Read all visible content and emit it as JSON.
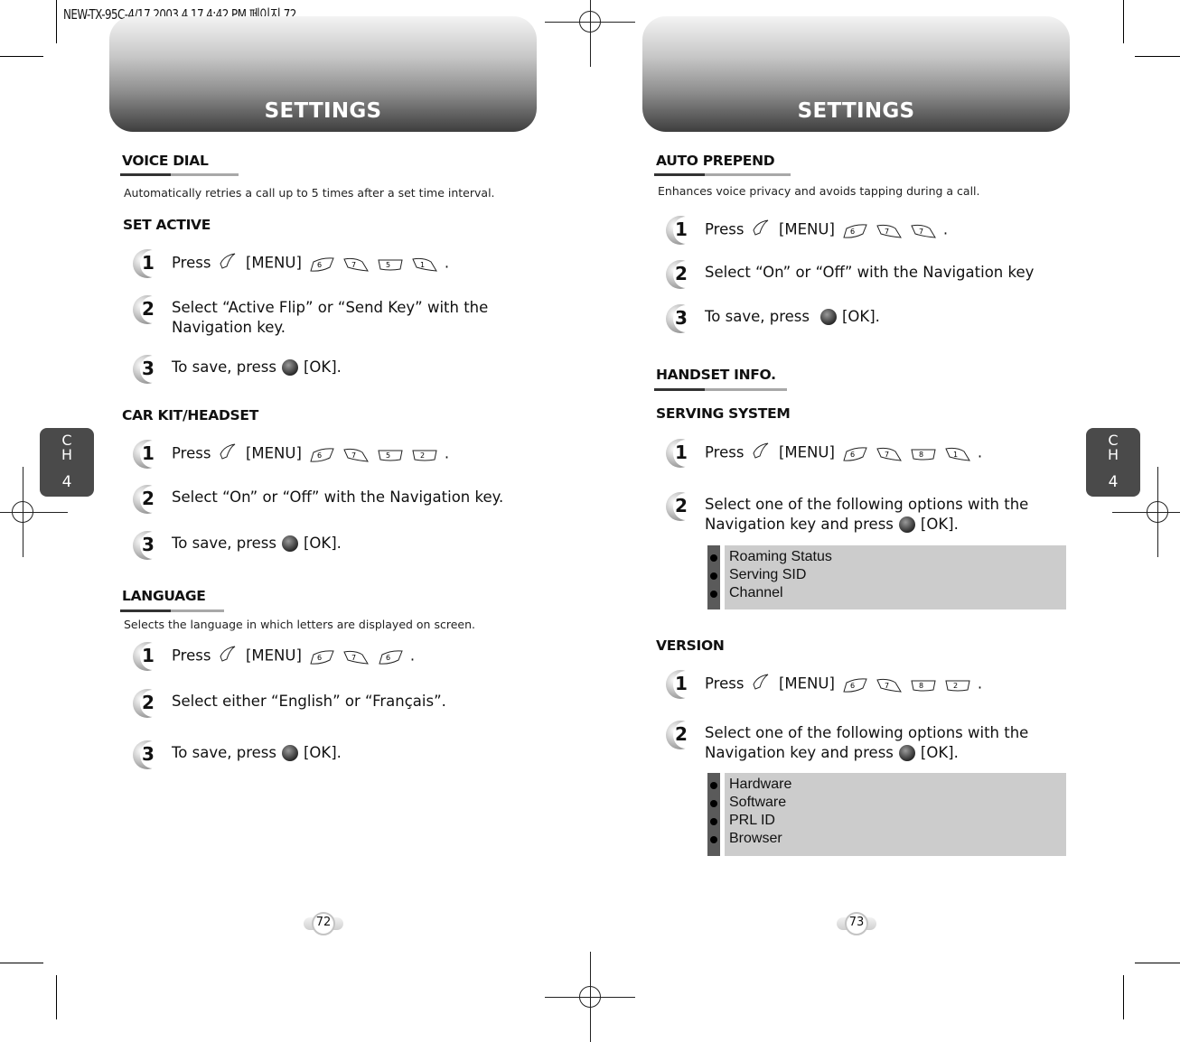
{
  "slug": "NEW-TX-95C-4/17  2003.4.17 4:42 PM 페이지 72",
  "left_page": {
    "header": "SETTINGS",
    "chapter_tab": {
      "c": "C",
      "h": "H",
      "num": "4"
    },
    "page_number": "72",
    "voice_dial": {
      "title": "VOICE DIAL",
      "description": "Automatically retries a call up to 5 times after a set time interval.",
      "set_active": {
        "title": "SET ACTIVE",
        "steps": [
          {
            "num": "1",
            "pre": "Press",
            "menu": "[MENU]",
            "keys": [
              "6",
              "7",
              "5",
              "1"
            ],
            "post": "."
          },
          {
            "num": "2",
            "line1": "Select “Active Flip” or “Send Key” with the",
            "line2": "Navigation key."
          },
          {
            "num": "3",
            "pre": "To save, press",
            "post": "[OK]."
          }
        ]
      }
    },
    "car_kit": {
      "title": "CAR KIT/HEADSET",
      "steps": [
        {
          "num": "1",
          "pre": "Press",
          "menu": "[MENU]",
          "keys": [
            "6",
            "7",
            "5",
            "2"
          ],
          "post": "."
        },
        {
          "num": "2",
          "text": "Select “On” or “Off” with the Navigation key."
        },
        {
          "num": "3",
          "pre": "To save, press",
          "post": "[OK]."
        }
      ]
    },
    "language": {
      "title": "LANGUAGE",
      "description": "Selects the language in which letters are displayed on screen.",
      "steps": [
        {
          "num": "1",
          "pre": "Press",
          "menu": "[MENU]",
          "keys": [
            "6",
            "7",
            "6"
          ],
          "post": "."
        },
        {
          "num": "2",
          "text": "Select either “English” or “Français”."
        },
        {
          "num": "3",
          "pre": "To save, press",
          "post": "[OK]."
        }
      ]
    }
  },
  "right_page": {
    "header": "SETTINGS",
    "chapter_tab": {
      "c": "C",
      "h": "H",
      "num": "4"
    },
    "page_number": "73",
    "auto_prepend": {
      "title": "AUTO PREPEND",
      "description": "Enhances voice privacy and avoids tapping during a call.",
      "steps": [
        {
          "num": "1",
          "pre": "Press",
          "menu": "[MENU]",
          "keys": [
            "6",
            "7",
            "7"
          ],
          "post": "."
        },
        {
          "num": "2",
          "text": "Select “On” or “Off” with the Navigation key"
        },
        {
          "num": "3",
          "pre": "To save, press",
          "post": "[OK]."
        }
      ]
    },
    "handset_info": {
      "title": "HANDSET INFO.",
      "serving_system": {
        "title": "SERVING SYSTEM",
        "steps": [
          {
            "num": "1",
            "pre": "Press",
            "menu": "[MENU]",
            "keys": [
              "6",
              "7",
              "8",
              "1"
            ],
            "post": "."
          },
          {
            "num": "2",
            "line1": "Select one of the following options with the",
            "line2_pre": "Navigation key and press",
            "line2_post": "[OK]."
          }
        ],
        "options": [
          "Roaming Status",
          "Serving SID",
          "Channel"
        ]
      },
      "version": {
        "title": "VERSION",
        "steps": [
          {
            "num": "1",
            "pre": "Press",
            "menu": "[MENU]",
            "keys": [
              "6",
              "7",
              "8",
              "2"
            ],
            "post": "."
          },
          {
            "num": "2",
            "line1": "Select one of the following options with the",
            "line2_pre": "Navigation key and press",
            "line2_post": "[OK]."
          }
        ],
        "options": [
          "Hardware",
          "Software",
          "PRL ID",
          "Browser"
        ]
      }
    }
  }
}
